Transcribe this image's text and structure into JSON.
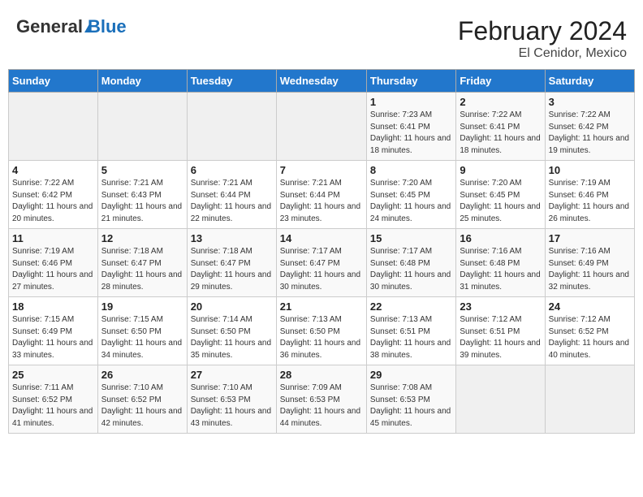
{
  "header": {
    "logo_general": "General",
    "logo_blue": "Blue",
    "title": "February 2024",
    "subtitle": "El Cenidor, Mexico"
  },
  "weekdays": [
    "Sunday",
    "Monday",
    "Tuesday",
    "Wednesday",
    "Thursday",
    "Friday",
    "Saturday"
  ],
  "weeks": [
    [
      {
        "day": "",
        "sunrise": "",
        "sunset": "",
        "daylight": ""
      },
      {
        "day": "",
        "sunrise": "",
        "sunset": "",
        "daylight": ""
      },
      {
        "day": "",
        "sunrise": "",
        "sunset": "",
        "daylight": ""
      },
      {
        "day": "",
        "sunrise": "",
        "sunset": "",
        "daylight": ""
      },
      {
        "day": "1",
        "sunrise": "Sunrise: 7:23 AM",
        "sunset": "Sunset: 6:41 PM",
        "daylight": "Daylight: 11 hours and 18 minutes."
      },
      {
        "day": "2",
        "sunrise": "Sunrise: 7:22 AM",
        "sunset": "Sunset: 6:41 PM",
        "daylight": "Daylight: 11 hours and 18 minutes."
      },
      {
        "day": "3",
        "sunrise": "Sunrise: 7:22 AM",
        "sunset": "Sunset: 6:42 PM",
        "daylight": "Daylight: 11 hours and 19 minutes."
      }
    ],
    [
      {
        "day": "4",
        "sunrise": "Sunrise: 7:22 AM",
        "sunset": "Sunset: 6:42 PM",
        "daylight": "Daylight: 11 hours and 20 minutes."
      },
      {
        "day": "5",
        "sunrise": "Sunrise: 7:21 AM",
        "sunset": "Sunset: 6:43 PM",
        "daylight": "Daylight: 11 hours and 21 minutes."
      },
      {
        "day": "6",
        "sunrise": "Sunrise: 7:21 AM",
        "sunset": "Sunset: 6:44 PM",
        "daylight": "Daylight: 11 hours and 22 minutes."
      },
      {
        "day": "7",
        "sunrise": "Sunrise: 7:21 AM",
        "sunset": "Sunset: 6:44 PM",
        "daylight": "Daylight: 11 hours and 23 minutes."
      },
      {
        "day": "8",
        "sunrise": "Sunrise: 7:20 AM",
        "sunset": "Sunset: 6:45 PM",
        "daylight": "Daylight: 11 hours and 24 minutes."
      },
      {
        "day": "9",
        "sunrise": "Sunrise: 7:20 AM",
        "sunset": "Sunset: 6:45 PM",
        "daylight": "Daylight: 11 hours and 25 minutes."
      },
      {
        "day": "10",
        "sunrise": "Sunrise: 7:19 AM",
        "sunset": "Sunset: 6:46 PM",
        "daylight": "Daylight: 11 hours and 26 minutes."
      }
    ],
    [
      {
        "day": "11",
        "sunrise": "Sunrise: 7:19 AM",
        "sunset": "Sunset: 6:46 PM",
        "daylight": "Daylight: 11 hours and 27 minutes."
      },
      {
        "day": "12",
        "sunrise": "Sunrise: 7:18 AM",
        "sunset": "Sunset: 6:47 PM",
        "daylight": "Daylight: 11 hours and 28 minutes."
      },
      {
        "day": "13",
        "sunrise": "Sunrise: 7:18 AM",
        "sunset": "Sunset: 6:47 PM",
        "daylight": "Daylight: 11 hours and 29 minutes."
      },
      {
        "day": "14",
        "sunrise": "Sunrise: 7:17 AM",
        "sunset": "Sunset: 6:47 PM",
        "daylight": "Daylight: 11 hours and 30 minutes."
      },
      {
        "day": "15",
        "sunrise": "Sunrise: 7:17 AM",
        "sunset": "Sunset: 6:48 PM",
        "daylight": "Daylight: 11 hours and 30 minutes."
      },
      {
        "day": "16",
        "sunrise": "Sunrise: 7:16 AM",
        "sunset": "Sunset: 6:48 PM",
        "daylight": "Daylight: 11 hours and 31 minutes."
      },
      {
        "day": "17",
        "sunrise": "Sunrise: 7:16 AM",
        "sunset": "Sunset: 6:49 PM",
        "daylight": "Daylight: 11 hours and 32 minutes."
      }
    ],
    [
      {
        "day": "18",
        "sunrise": "Sunrise: 7:15 AM",
        "sunset": "Sunset: 6:49 PM",
        "daylight": "Daylight: 11 hours and 33 minutes."
      },
      {
        "day": "19",
        "sunrise": "Sunrise: 7:15 AM",
        "sunset": "Sunset: 6:50 PM",
        "daylight": "Daylight: 11 hours and 34 minutes."
      },
      {
        "day": "20",
        "sunrise": "Sunrise: 7:14 AM",
        "sunset": "Sunset: 6:50 PM",
        "daylight": "Daylight: 11 hours and 35 minutes."
      },
      {
        "day": "21",
        "sunrise": "Sunrise: 7:13 AM",
        "sunset": "Sunset: 6:50 PM",
        "daylight": "Daylight: 11 hours and 36 minutes."
      },
      {
        "day": "22",
        "sunrise": "Sunrise: 7:13 AM",
        "sunset": "Sunset: 6:51 PM",
        "daylight": "Daylight: 11 hours and 38 minutes."
      },
      {
        "day": "23",
        "sunrise": "Sunrise: 7:12 AM",
        "sunset": "Sunset: 6:51 PM",
        "daylight": "Daylight: 11 hours and 39 minutes."
      },
      {
        "day": "24",
        "sunrise": "Sunrise: 7:12 AM",
        "sunset": "Sunset: 6:52 PM",
        "daylight": "Daylight: 11 hours and 40 minutes."
      }
    ],
    [
      {
        "day": "25",
        "sunrise": "Sunrise: 7:11 AM",
        "sunset": "Sunset: 6:52 PM",
        "daylight": "Daylight: 11 hours and 41 minutes."
      },
      {
        "day": "26",
        "sunrise": "Sunrise: 7:10 AM",
        "sunset": "Sunset: 6:52 PM",
        "daylight": "Daylight: 11 hours and 42 minutes."
      },
      {
        "day": "27",
        "sunrise": "Sunrise: 7:10 AM",
        "sunset": "Sunset: 6:53 PM",
        "daylight": "Daylight: 11 hours and 43 minutes."
      },
      {
        "day": "28",
        "sunrise": "Sunrise: 7:09 AM",
        "sunset": "Sunset: 6:53 PM",
        "daylight": "Daylight: 11 hours and 44 minutes."
      },
      {
        "day": "29",
        "sunrise": "Sunrise: 7:08 AM",
        "sunset": "Sunset: 6:53 PM",
        "daylight": "Daylight: 11 hours and 45 minutes."
      },
      {
        "day": "",
        "sunrise": "",
        "sunset": "",
        "daylight": ""
      },
      {
        "day": "",
        "sunrise": "",
        "sunset": "",
        "daylight": ""
      }
    ]
  ]
}
